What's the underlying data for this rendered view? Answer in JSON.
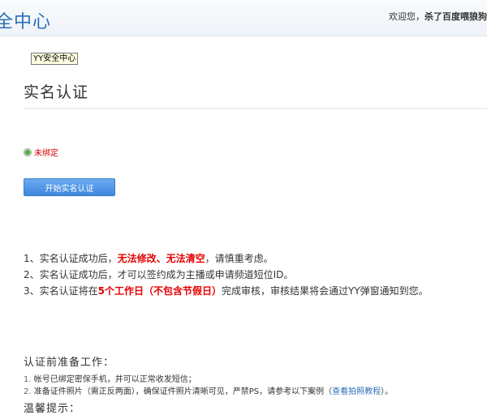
{
  "header": {
    "logo_text": "全中心",
    "welcome_prefix": "欢迎您，",
    "username": "杀了百度喂狼狗"
  },
  "tooltip": "YY安全中心",
  "page": {
    "title": "实名认证",
    "status_text": "未绑定",
    "start_button": "开始实名认证"
  },
  "rules": [
    {
      "num": "1、",
      "pre": "实名认证成功后，",
      "red": "无法修改、无法清空",
      "post": "，请慎重考虑。"
    },
    {
      "num": "2、",
      "pre": "实名认证成功后，才可以签约成为主播或申请频道短位ID。",
      "red": "",
      "post": ""
    },
    {
      "num": "3、",
      "pre": "实名认证将在",
      "red": "5个工作日（不包含节假日）",
      "post": "完成审核，审核结果将会通过YY弹窗通知到您。"
    }
  ],
  "prep": {
    "title": "认证前准备工作：",
    "items": [
      {
        "num": "1.",
        "text": "帐号已绑定密保手机，并可以正常收发短信；",
        "link": "",
        "tail": ""
      },
      {
        "num": "2.",
        "text": "准备证件照片（需正反两面），确保证件照片清晰可见，严禁PS，请参考以下案例（",
        "link": "查看拍照教程",
        "tail": "）。"
      }
    ],
    "tips_title": "温馨提示："
  }
}
